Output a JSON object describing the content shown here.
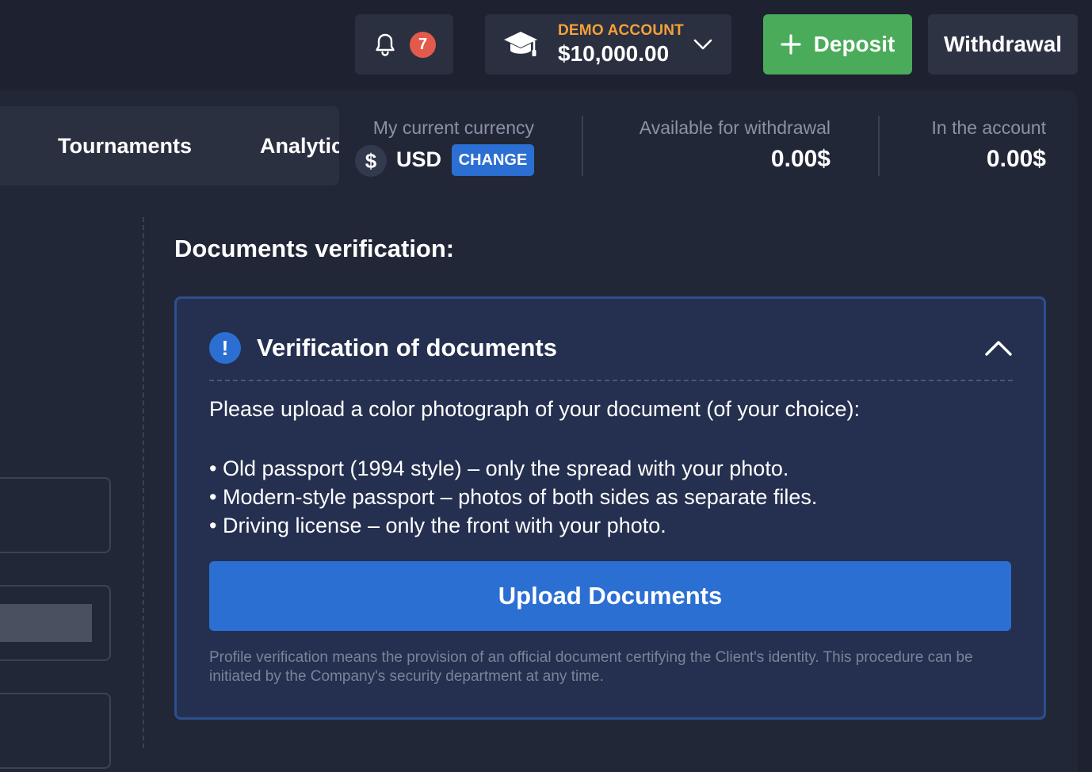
{
  "header": {
    "notifications": {
      "count": "7",
      "icon": "bell-icon"
    },
    "account": {
      "type": "DEMO ACCOUNT",
      "balance": "$10,000.00",
      "icon": "graduation-cap-icon"
    },
    "deposit_label": "Deposit",
    "withdrawal_label": "Withdrawal"
  },
  "tabs": [
    {
      "label": "Tournaments"
    },
    {
      "label": "Analytic"
    }
  ],
  "currency": {
    "label": "My current currency",
    "symbol": "$",
    "code": "USD",
    "change_label": "CHANGE"
  },
  "stats": {
    "available": {
      "label": "Available for withdrawal",
      "value": "0.00$"
    },
    "account": {
      "label": "In the account",
      "value": "0.00$"
    }
  },
  "section": {
    "title": "Documents verification:"
  },
  "card": {
    "title": "Verification of documents",
    "info_symbol": "!",
    "intro": "Please upload a color photograph of your document (of your choice):",
    "items": [
      "• Old passport (1994 style) – only the spread with your photo.",
      "• Modern-style passport – photos of both sides as separate files.",
      "• Driving license – only the front with your photo."
    ],
    "upload_label": "Upload Documents",
    "note": "Profile verification means the provision of an official document certifying the Client's identity. This procedure can be initiated by the Company's security department at any time."
  },
  "colors": {
    "deposit": "#4aab5a",
    "primary": "#2c6fd3",
    "badge": "#e35a4b",
    "demo_label": "#f5a13a"
  }
}
